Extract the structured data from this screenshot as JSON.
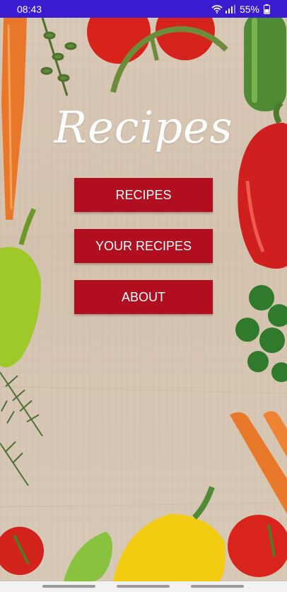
{
  "status_bar": {
    "time": "08:43",
    "battery": "55%",
    "icons": [
      "wifi-icon",
      "signal-icon",
      "battery-icon"
    ],
    "background": "#3a1bcf"
  },
  "app": {
    "title": "Recipes",
    "menu": [
      {
        "label": "RECIPES"
      },
      {
        "label": "YOUR RECIPES"
      },
      {
        "label": "ABOUT"
      }
    ],
    "button_color": "#b10f20"
  },
  "navigation_bar": {
    "items": [
      "nav-back",
      "nav-home",
      "nav-recents"
    ]
  }
}
